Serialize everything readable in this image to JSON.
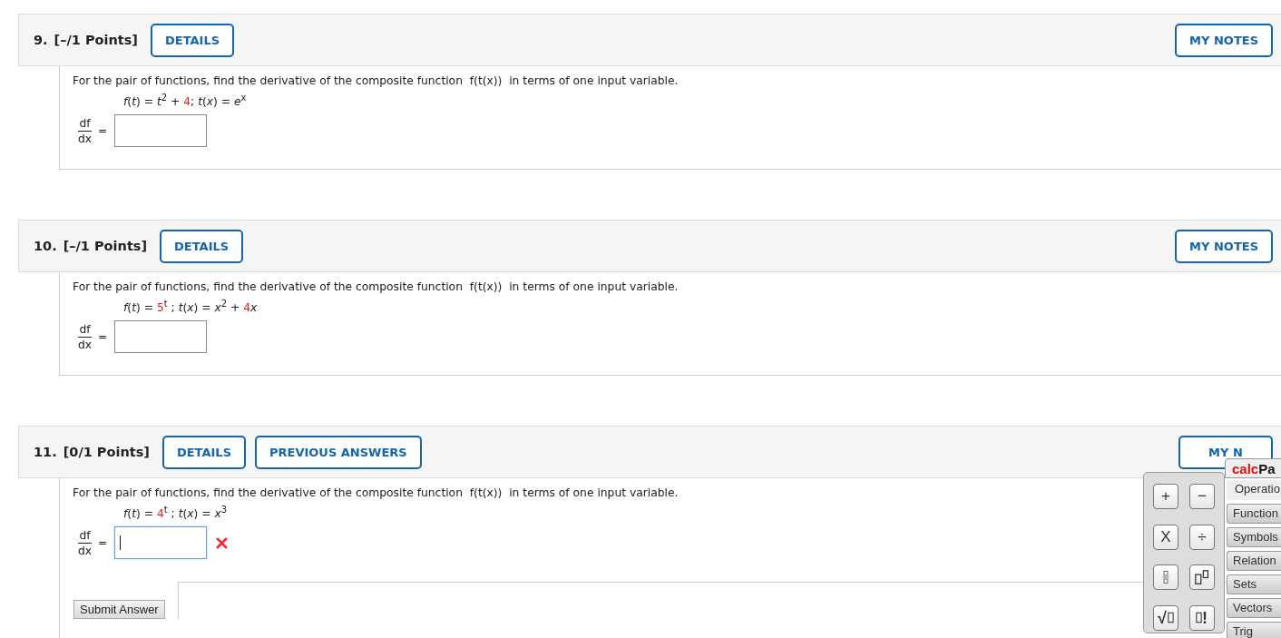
{
  "questions": [
    {
      "number": "9.",
      "points": "[–/1 Points]",
      "buttons": [
        {
          "label": "DETAILS"
        }
      ],
      "notes_button": "MY NOTES",
      "prompt": "For the pair of functions, find the derivative of the composite function  f(t(x))  in terms of one input variable.",
      "formula": [
        {
          "kind": "var",
          "text": "f"
        },
        {
          "kind": "op",
          "text": "("
        },
        {
          "kind": "var",
          "text": "t"
        },
        {
          "kind": "op",
          "text": ") = "
        },
        {
          "kind": "var",
          "text": "t"
        },
        {
          "kind": "sup",
          "text": "2"
        },
        {
          "kind": "op",
          "text": " + "
        },
        {
          "kind": "num",
          "text": "4"
        },
        {
          "kind": "op",
          "text": "; "
        },
        {
          "kind": "var",
          "text": "t"
        },
        {
          "kind": "op",
          "text": "("
        },
        {
          "kind": "var",
          "text": "x"
        },
        {
          "kind": "op",
          "text": ") = "
        },
        {
          "kind": "var",
          "text": "e"
        },
        {
          "kind": "sup",
          "text": "x"
        }
      ],
      "answer": {
        "numerator": "df",
        "denominator": "dx",
        "equals": "=",
        "focused": false
      }
    },
    {
      "number": "10.",
      "points": "[–/1 Points]",
      "buttons": [
        {
          "label": "DETAILS"
        }
      ],
      "notes_button": "MY NOTES",
      "prompt": "For the pair of functions, find the derivative of the composite function  f(t(x))  in terms of one input variable.",
      "formula": [
        {
          "kind": "var",
          "text": "f"
        },
        {
          "kind": "op",
          "text": "("
        },
        {
          "kind": "var",
          "text": "t"
        },
        {
          "kind": "op",
          "text": ") = "
        },
        {
          "kind": "num",
          "text": "5"
        },
        {
          "kind": "sup",
          "text": "t"
        },
        {
          "kind": "op",
          "text": " ; "
        },
        {
          "kind": "var",
          "text": "t"
        },
        {
          "kind": "op",
          "text": "("
        },
        {
          "kind": "var",
          "text": "x"
        },
        {
          "kind": "op",
          "text": ") = "
        },
        {
          "kind": "var",
          "text": "x"
        },
        {
          "kind": "sup",
          "text": "2"
        },
        {
          "kind": "op",
          "text": " + "
        },
        {
          "kind": "num",
          "text": "4"
        },
        {
          "kind": "var",
          "text": "x"
        }
      ],
      "answer": {
        "numerator": "df",
        "denominator": "dx",
        "equals": "=",
        "focused": false
      }
    },
    {
      "number": "11.",
      "points": "[0/1 Points]",
      "buttons": [
        {
          "label": "DETAILS"
        },
        {
          "label": "PREVIOUS ANSWERS"
        }
      ],
      "notes_button": "MY N",
      "prompt": "For the pair of functions, find the derivative of the composite function  f(t(x))  in terms of one input variable.",
      "formula": [
        {
          "kind": "var",
          "text": "f"
        },
        {
          "kind": "op",
          "text": "("
        },
        {
          "kind": "var",
          "text": "t"
        },
        {
          "kind": "op",
          "text": ") = "
        },
        {
          "kind": "num",
          "text": "4"
        },
        {
          "kind": "sup",
          "text": "t"
        },
        {
          "kind": "op",
          "text": " ; "
        },
        {
          "kind": "var",
          "text": "t"
        },
        {
          "kind": "op",
          "text": "("
        },
        {
          "kind": "var",
          "text": "x"
        },
        {
          "kind": "op",
          "text": ") = "
        },
        {
          "kind": "var",
          "text": "x"
        },
        {
          "kind": "sup",
          "text": "3"
        }
      ],
      "answer": {
        "numerator": "df",
        "denominator": "dx",
        "equals": "=",
        "focused": true,
        "incorrect": true
      },
      "submit": "Submit Answer"
    }
  ],
  "calcpad": {
    "title_accent": "calc",
    "title_rest": "Pa",
    "keys": [
      {
        "kind": "text",
        "label": "+"
      },
      {
        "kind": "text",
        "label": "−"
      },
      {
        "kind": "text",
        "label": "X"
      },
      {
        "kind": "text",
        "label": "÷"
      },
      {
        "kind": "fraction"
      },
      {
        "kind": "power"
      },
      {
        "kind": "sqrt",
        "label": "√"
      },
      {
        "kind": "factorial",
        "label": "!"
      }
    ],
    "tabs": [
      {
        "label": "Operatio",
        "selected": true
      },
      {
        "label": "Function",
        "selected": false
      },
      {
        "label": "Symbols",
        "selected": false
      },
      {
        "label": "Relation",
        "selected": false
      },
      {
        "label": "Sets",
        "selected": false
      },
      {
        "label": "Vectors",
        "selected": false
      },
      {
        "label": "Trig",
        "selected": false
      }
    ]
  }
}
